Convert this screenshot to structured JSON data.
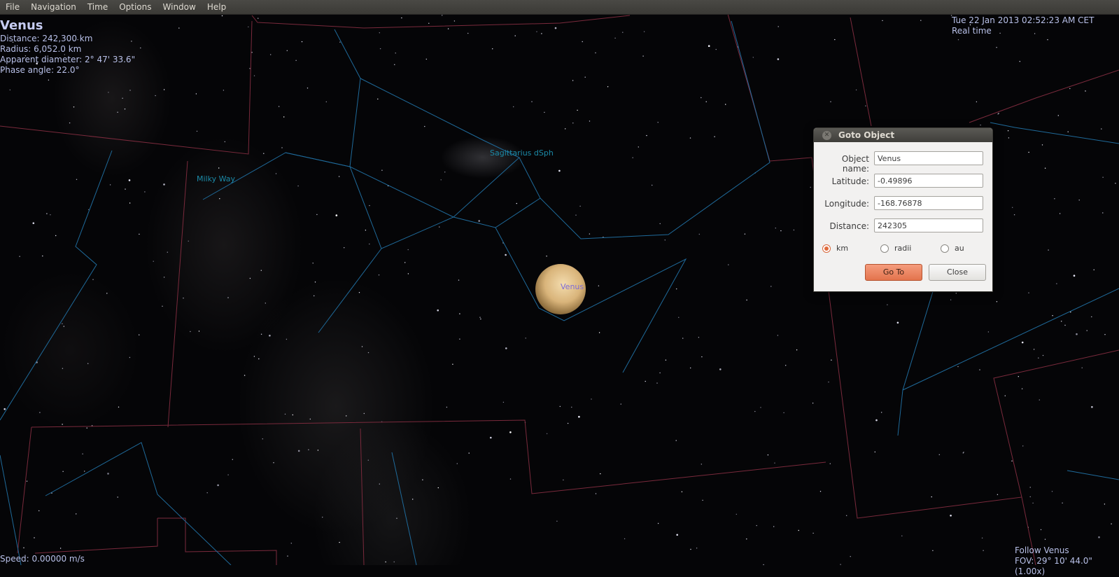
{
  "menubar": {
    "items": [
      "File",
      "Navigation",
      "Time",
      "Options",
      "Window",
      "Help"
    ]
  },
  "info": {
    "object_name": "Venus",
    "distance": "Distance: 242,300 km",
    "radius": "Radius: 6,052.0 km",
    "apparent_diameter": "Apparent diameter: 2° 47' 33.6\"",
    "phase_angle": "Phase angle: 22.0°"
  },
  "datetime": {
    "date": "Tue 22 Jan 2013 02:52:23 AM CET",
    "mode": "Real time"
  },
  "status": {
    "speed": "Speed: 0.00000 m/s",
    "follow": "Follow Venus",
    "fov": "FOV: 29° 10' 44.0\" (1.00x)"
  },
  "sky_labels": {
    "milky_way": "Milky Way",
    "sagittarius": "Sagittarius dSph",
    "venus": "Venus"
  },
  "colors": {
    "constellation_line": "#1f6a9a",
    "boundary_line": "#7a2a3c",
    "label_teal": "#1b8aa8",
    "label_venus": "#7c6ad8",
    "accent": "#e3744d"
  },
  "dialog": {
    "title": "Goto Object",
    "object_name_label": "Object name:",
    "object_name_value": "Venus",
    "latitude_label": "Latitude:",
    "latitude_value": "-0.49896",
    "longitude_label": "Longitude:",
    "longitude_value": "-168.76878",
    "distance_label": "Distance:",
    "distance_value": "242305",
    "units": [
      "km",
      "radii",
      "au"
    ],
    "selected_unit": "km",
    "goto_label": "Go To",
    "close_label": "Close"
  }
}
